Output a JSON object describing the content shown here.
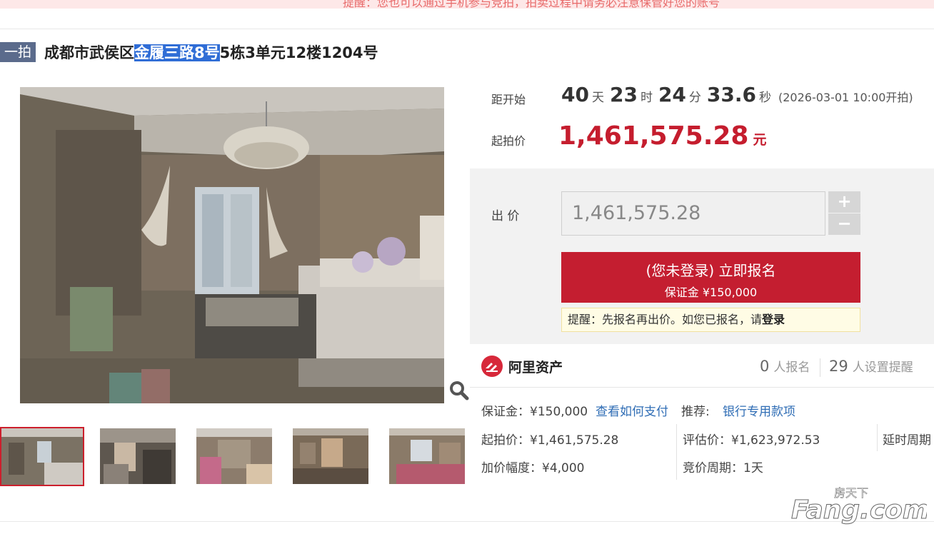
{
  "banner": {
    "text": "提醒：您也可以通过手机参与竞拍，拍卖过程中请务必注意保管好您的账号"
  },
  "listing": {
    "round": "一拍",
    "title_prefix": "成都市武侯区",
    "title_highlight": "金履三路8号",
    "title_suffix": "5栋3单元12楼1204号"
  },
  "countdown": {
    "label": "距开始",
    "days": "40",
    "days_unit": "天",
    "hours": "23",
    "hours_unit": "时",
    "minutes": "24",
    "minutes_unit": "分",
    "seconds": "33.6",
    "seconds_unit": "秒",
    "start_time": "(2026-03-01 10:00开拍)"
  },
  "price": {
    "label": "起拍价",
    "value": "1,461,575.28",
    "unit": "元"
  },
  "bid": {
    "label": "出 价",
    "input_value": "1,461,575.28",
    "plus": "+",
    "minus": "−",
    "signup_line1": "(您未登录) 立即报名",
    "signup_line2": "保证金 ¥150,000",
    "reminder_text": "提醒：先报名再出价。如您已报名，请",
    "reminder_link": "登录"
  },
  "platform": {
    "name": "阿里资产",
    "signups": "0",
    "signups_label": "人报名",
    "reminders": "29",
    "reminders_label": "人设置提醒"
  },
  "details": {
    "deposit": "保证金：¥150,000",
    "how_to_pay": "查看如何支付",
    "recommend_label": "推荐:",
    "recommend_link": "银行专用款项",
    "start_price": "起拍价：¥1,461,575.28",
    "appraisal": "评估价：¥1,623,972.53",
    "delay_period": "延时周期",
    "increment": "加价幅度：¥4,000",
    "auction_period": "竞价周期：1天"
  },
  "watermark": {
    "line1": "房天下",
    "line2": "Fang.com"
  },
  "colors": {
    "accent": "#c41e30",
    "highlight": "#2f6dd6",
    "link": "#2f6db5",
    "badge": "#5b6b8c"
  }
}
